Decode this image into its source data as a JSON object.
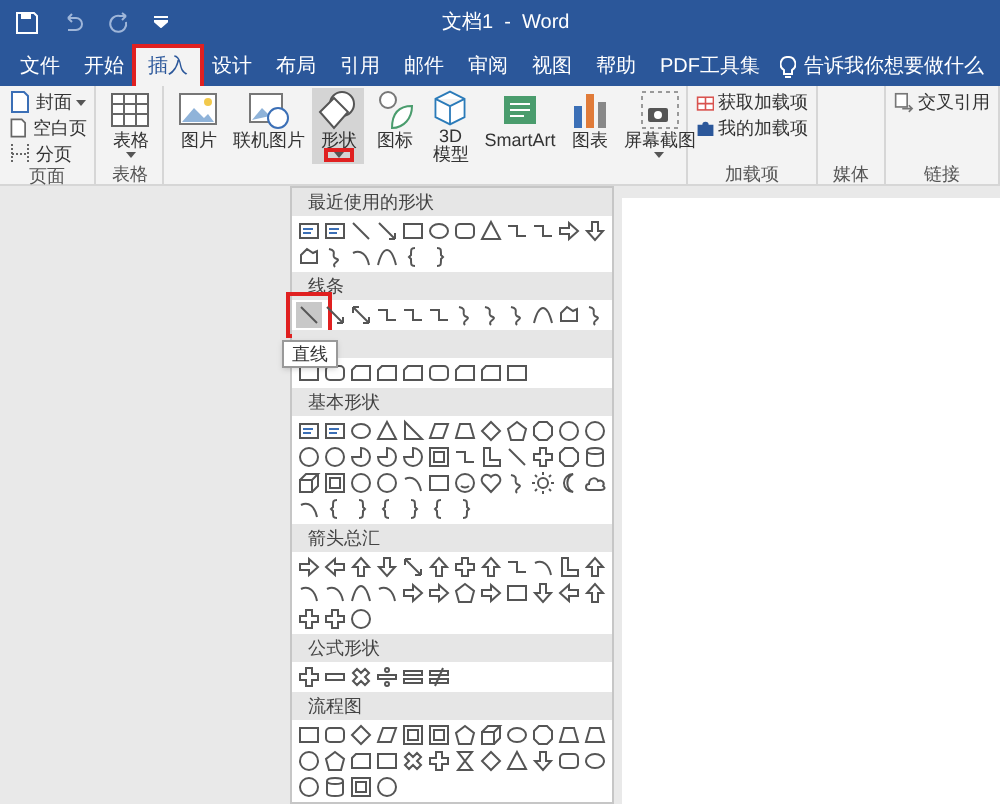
{
  "window": {
    "title": "文档1  -  Word"
  },
  "tabs": [
    {
      "label": "文件",
      "selected": false
    },
    {
      "label": "开始",
      "selected": false
    },
    {
      "label": "插入",
      "selected": true
    },
    {
      "label": "设计",
      "selected": false
    },
    {
      "label": "布局",
      "selected": false
    },
    {
      "label": "引用",
      "selected": false
    },
    {
      "label": "邮件",
      "selected": false
    },
    {
      "label": "审阅",
      "selected": false
    },
    {
      "label": "视图",
      "selected": false
    },
    {
      "label": "帮助",
      "selected": false
    },
    {
      "label": "PDF工具集",
      "selected": false
    }
  ],
  "tell_me": {
    "placeholder": "告诉我你想要做什么"
  },
  "ribbon": {
    "groups": [
      {
        "label": "页面",
        "kind": "small",
        "items": [
          {
            "label": "封面",
            "kind": "page",
            "dropdown": true
          },
          {
            "label": "空白页",
            "kind": "blank",
            "dropdown": false
          },
          {
            "label": "分页",
            "kind": "break",
            "dropdown": false
          }
        ]
      },
      {
        "label": "表格",
        "kind": "large",
        "items": [
          {
            "label": "表格",
            "kind": "table",
            "dropdown": true,
            "active": false
          }
        ]
      },
      {
        "kind": "large",
        "items": [
          {
            "label": "图片",
            "kind": "picture",
            "dropdown": false,
            "active": false
          },
          {
            "label": "联机图片",
            "kind": "online",
            "dropdown": false,
            "active": false
          },
          {
            "label": "形状",
            "kind": "shapes",
            "dropdown": true,
            "active": true
          },
          {
            "label": "图标",
            "kind": "icons",
            "dropdown": false,
            "active": false
          },
          {
            "label": "3D\n模型",
            "kind": "cube",
            "dropdown": false,
            "active": false
          },
          {
            "label": "SmartArt",
            "kind": "smartart",
            "dropdown": false,
            "active": false
          },
          {
            "label": "图表",
            "kind": "chart",
            "dropdown": false,
            "active": false
          },
          {
            "label": "屏幕截图",
            "kind": "screenshot",
            "dropdown": true,
            "active": false
          }
        ]
      },
      {
        "label": "加载项",
        "kind": "small",
        "items": [
          {
            "label": "获取加载项",
            "kind": "store",
            "dropdown": false
          },
          {
            "label": "我的加载项",
            "kind": "addin",
            "dropdown": false
          }
        ]
      },
      {
        "label": "媒体",
        "kind": "small"
      },
      {
        "label": "链接",
        "kind": "small",
        "items": [
          {
            "label": "交叉引用",
            "kind": "xref",
            "dropdown": false
          }
        ]
      }
    ]
  },
  "shapes_menu": {
    "tooltip": "直线",
    "sections": [
      {
        "title": "最近使用的形状",
        "shapes": [
          {
            "kind": "textbox",
            "selected": false
          },
          {
            "kind": "textbox",
            "selected": false
          },
          {
            "kind": "line",
            "selected": false
          },
          {
            "kind": "arrowline",
            "selected": false
          },
          {
            "kind": "rect",
            "selected": false
          },
          {
            "kind": "oval",
            "selected": false
          },
          {
            "kind": "rounded",
            "selected": false
          },
          {
            "kind": "triangle",
            "selected": false
          },
          {
            "kind": "elbow",
            "selected": false
          },
          {
            "kind": "elbow",
            "selected": false
          },
          {
            "kind": "arrowright",
            "selected": false
          },
          {
            "kind": "arrowdown",
            "selected": false
          },
          {
            "kind": "freeform",
            "selected": false
          },
          {
            "kind": "scribble",
            "selected": false
          },
          {
            "kind": "arc",
            "selected": false
          },
          {
            "kind": "curve",
            "selected": false
          },
          {
            "kind": "bracketl",
            "selected": false
          },
          {
            "kind": "bracketr",
            "selected": false
          }
        ]
      },
      {
        "title": "线条",
        "shapes": [
          {
            "kind": "line",
            "selected": true
          },
          {
            "kind": "arrowline",
            "selected": false
          },
          {
            "kind": "dblarrow",
            "selected": false
          },
          {
            "kind": "elbow",
            "selected": false
          },
          {
            "kind": "elbow",
            "selected": false
          },
          {
            "kind": "elbow",
            "selected": false
          },
          {
            "kind": "scribble",
            "selected": false
          },
          {
            "kind": "scribble",
            "selected": false
          },
          {
            "kind": "scribble",
            "selected": false
          },
          {
            "kind": "curve",
            "selected": false
          },
          {
            "kind": "freeform",
            "selected": false
          },
          {
            "kind": "scribble",
            "selected": false
          }
        ]
      },
      {
        "shapes": [
          {
            "kind": "rect",
            "selected": false
          },
          {
            "kind": "rounded",
            "selected": false
          },
          {
            "kind": "snip",
            "selected": false
          },
          {
            "kind": "snip",
            "selected": false
          },
          {
            "kind": "snip",
            "selected": false
          },
          {
            "kind": "rounded",
            "selected": false
          },
          {
            "kind": "snip",
            "selected": false
          },
          {
            "kind": "snip",
            "selected": false
          },
          {
            "kind": "rect",
            "selected": false
          }
        ]
      },
      {
        "title": "基本形状",
        "shapes": [
          {
            "kind": "textbox",
            "selected": false
          },
          {
            "kind": "textbox",
            "selected": false
          },
          {
            "kind": "oval",
            "selected": false
          },
          {
            "kind": "triangle",
            "selected": false
          },
          {
            "kind": "rtriangle",
            "selected": false
          },
          {
            "kind": "parallelogram",
            "selected": false
          },
          {
            "kind": "trapezoid",
            "selected": false
          },
          {
            "kind": "diamond",
            "selected": false
          },
          {
            "kind": "pentagon",
            "selected": false
          },
          {
            "kind": "octagon",
            "selected": false
          },
          {
            "kind": "circle",
            "selected": false
          },
          {
            "kind": "circle",
            "selected": false
          },
          {
            "kind": "circle",
            "selected": false
          },
          {
            "kind": "circle",
            "selected": false
          },
          {
            "kind": "pie",
            "selected": false
          },
          {
            "kind": "pie",
            "selected": false
          },
          {
            "kind": "pie",
            "selected": false
          },
          {
            "kind": "frame",
            "selected": false
          },
          {
            "kind": "elbow",
            "selected": false
          },
          {
            "kind": "lshape",
            "selected": false
          },
          {
            "kind": "line",
            "selected": false
          },
          {
            "kind": "plus",
            "selected": false
          },
          {
            "kind": "octagon",
            "selected": false
          },
          {
            "kind": "can",
            "selected": false
          },
          {
            "kind": "cube",
            "selected": false
          },
          {
            "kind": "frame",
            "selected": false
          },
          {
            "kind": "circle",
            "selected": false
          },
          {
            "kind": "circle",
            "selected": false
          },
          {
            "kind": "arc",
            "selected": false
          },
          {
            "kind": "rect",
            "selected": false
          },
          {
            "kind": "smiley",
            "selected": false
          },
          {
            "kind": "heart",
            "selected": false
          },
          {
            "kind": "scribble",
            "selected": false
          },
          {
            "kind": "sun",
            "selected": false
          },
          {
            "kind": "moon",
            "selected": false
          },
          {
            "kind": "cloud",
            "selected": false
          },
          {
            "kind": "arc",
            "selected": false
          },
          {
            "kind": "bracketl",
            "selected": false
          },
          {
            "kind": "bracketr",
            "selected": false
          },
          {
            "kind": "bracketl",
            "selected": false
          },
          {
            "kind": "bracketr",
            "selected": false
          },
          {
            "kind": "bracketl",
            "selected": false
          },
          {
            "kind": "bracketr",
            "selected": false
          }
        ]
      },
      {
        "title": "箭头总汇",
        "shapes": [
          {
            "kind": "arrowright",
            "selected": false
          },
          {
            "kind": "arrowleft",
            "selected": false
          },
          {
            "kind": "arrowup",
            "selected": false
          },
          {
            "kind": "arrowdown",
            "selected": false
          },
          {
            "kind": "dblarrow",
            "selected": false
          },
          {
            "kind": "arrowup",
            "selected": false
          },
          {
            "kind": "plus",
            "selected": false
          },
          {
            "kind": "arrowup",
            "selected": false
          },
          {
            "kind": "elbow",
            "selected": false
          },
          {
            "kind": "arc",
            "selected": false
          },
          {
            "kind": "lshape",
            "selected": false
          },
          {
            "kind": "arrowup",
            "selected": false
          },
          {
            "kind": "arc",
            "selected": false
          },
          {
            "kind": "arc",
            "selected": false
          },
          {
            "kind": "curve",
            "selected": false
          },
          {
            "kind": "arc",
            "selected": false
          },
          {
            "kind": "arrowright",
            "selected": false
          },
          {
            "kind": "arrowright",
            "selected": false
          },
          {
            "kind": "pentagon",
            "selected": false
          },
          {
            "kind": "arrowright",
            "selected": false
          },
          {
            "kind": "rect",
            "selected": false
          },
          {
            "kind": "arrowdown",
            "selected": false
          },
          {
            "kind": "arrowleft",
            "selected": false
          },
          {
            "kind": "arrowup",
            "selected": false
          },
          {
            "kind": "plus",
            "selected": false
          },
          {
            "kind": "plus",
            "selected": false
          },
          {
            "kind": "circle",
            "selected": false
          }
        ]
      },
      {
        "title": "公式形状",
        "shapes": [
          {
            "kind": "plus",
            "selected": false
          },
          {
            "kind": "minus",
            "selected": false
          },
          {
            "kind": "times",
            "selected": false
          },
          {
            "kind": "divide",
            "selected": false
          },
          {
            "kind": "equal",
            "selected": false
          },
          {
            "kind": "notequal",
            "selected": false
          }
        ]
      },
      {
        "title": "流程图",
        "shapes": [
          {
            "kind": "rect",
            "selected": false
          },
          {
            "kind": "rounded",
            "selected": false
          },
          {
            "kind": "diamond",
            "selected": false
          },
          {
            "kind": "parallelogram",
            "selected": false
          },
          {
            "kind": "frame",
            "selected": false
          },
          {
            "kind": "frame",
            "selected": false
          },
          {
            "kind": "pentagon",
            "selected": false
          },
          {
            "kind": "cube",
            "selected": false
          },
          {
            "kind": "oval",
            "selected": false
          },
          {
            "kind": "octagon",
            "selected": false
          },
          {
            "kind": "trapezoid",
            "selected": false
          },
          {
            "kind": "trapezoid",
            "selected": false
          },
          {
            "kind": "circle",
            "selected": false
          },
          {
            "kind": "pentagon",
            "selected": false
          },
          {
            "kind": "snip",
            "selected": false
          },
          {
            "kind": "rect",
            "selected": false
          },
          {
            "kind": "times",
            "selected": false
          },
          {
            "kind": "plus",
            "selected": false
          },
          {
            "kind": "hourglass",
            "selected": false
          },
          {
            "kind": "diamond",
            "selected": false
          },
          {
            "kind": "triangle",
            "selected": false
          },
          {
            "kind": "arrowdown",
            "selected": false
          },
          {
            "kind": "rounded",
            "selected": false
          },
          {
            "kind": "oval",
            "selected": false
          },
          {
            "kind": "circle",
            "selected": false
          },
          {
            "kind": "can",
            "selected": false
          },
          {
            "kind": "frame",
            "selected": false
          },
          {
            "kind": "circle",
            "selected": false
          }
        ]
      }
    ]
  }
}
